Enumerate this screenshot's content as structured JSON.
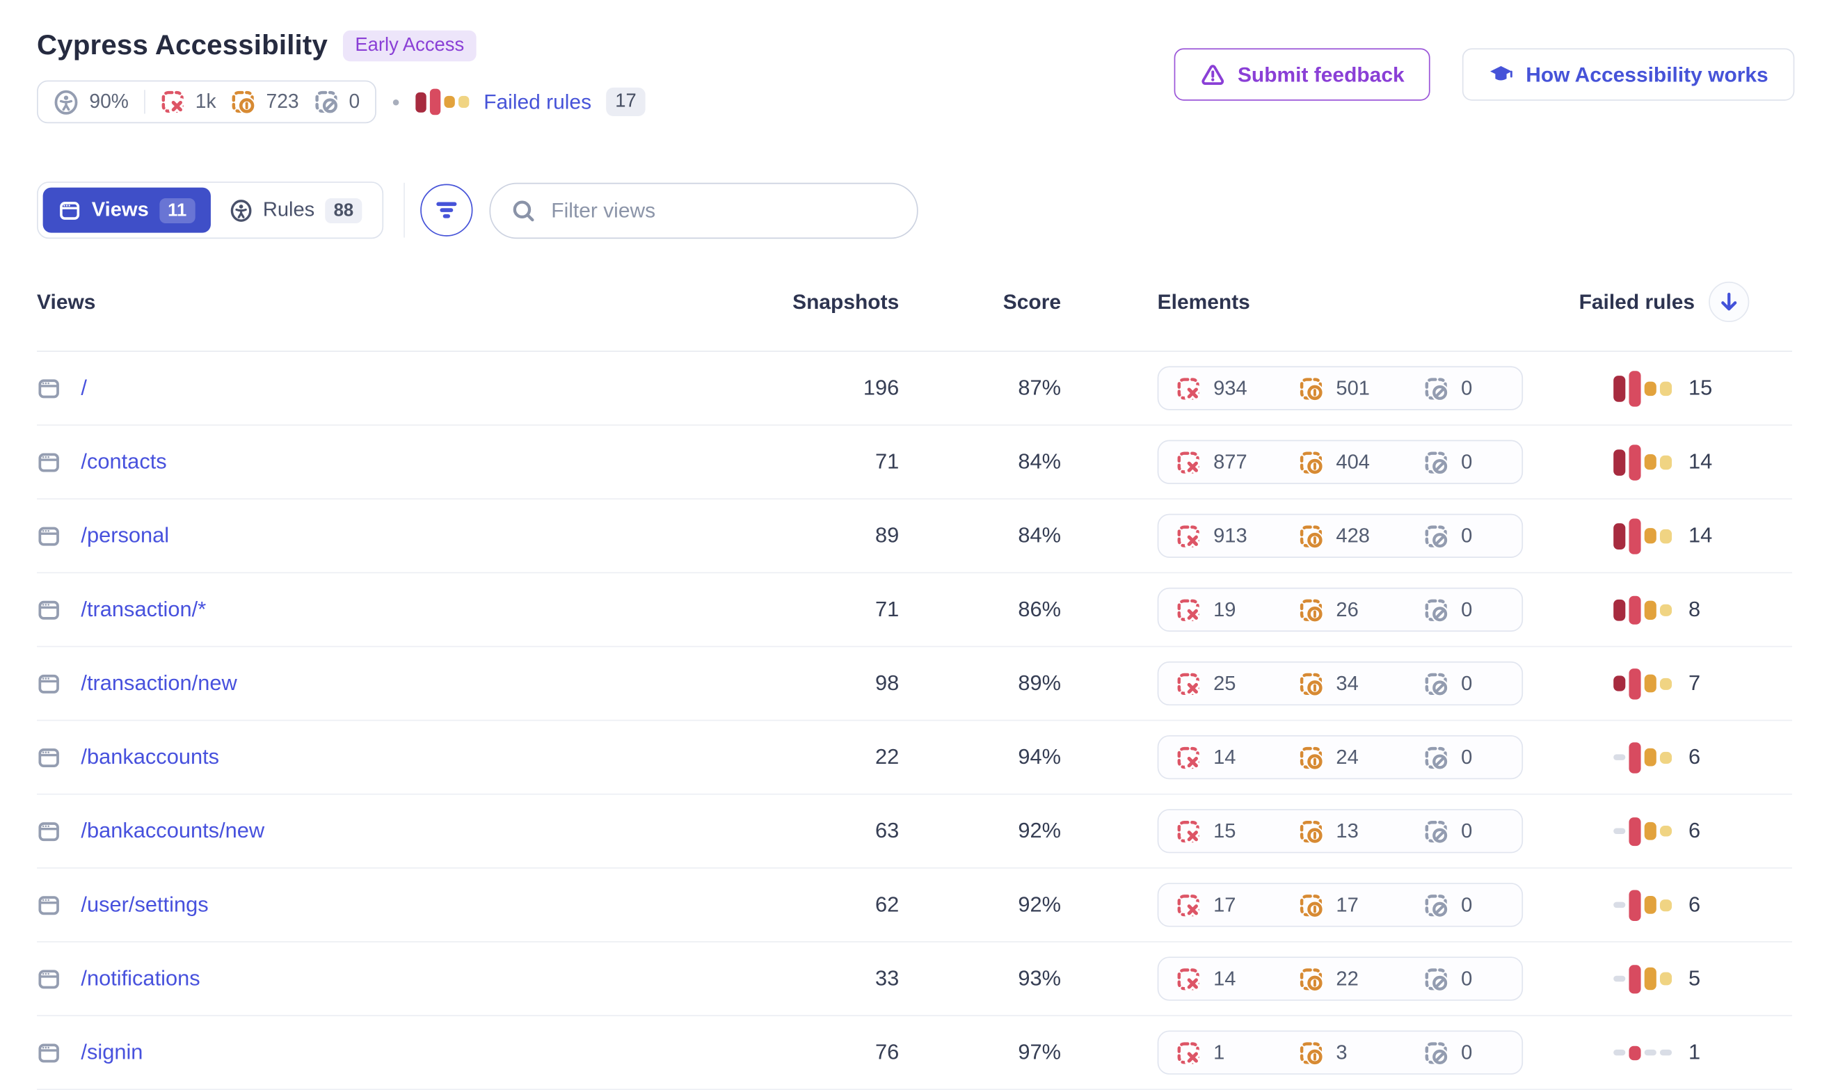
{
  "colors": {
    "accent": "#4653d8",
    "link": "#4751dd",
    "tab_active_bg": "#3f4fc8",
    "purple": "#8a3fd6",
    "purple_badge_bg": "#ede5fa",
    "critical": "#a72b3f",
    "serious": "#d84b60",
    "moderate": "#e2a23c",
    "minor": "#f0d483",
    "zero_dash": "#d9dde6",
    "failed_icon": "#dd5566",
    "inconclusive_icon": "#d78a33",
    "ignored_icon": "#939cb0"
  },
  "header": {
    "title": "Cypress Accessibility",
    "badge": "Early Access",
    "feedback_button": "Submit feedback",
    "docs_button": "How Accessibility works",
    "stats": {
      "score": "90%",
      "failed_elements": "1k",
      "inconclusive_elements": "723",
      "ignored_elements": "0",
      "failed_rules_label": "Failed rules",
      "failed_rules_count": "17",
      "severity_bars": [
        17,
        22,
        10,
        10
      ]
    }
  },
  "toolbar": {
    "views_tab": {
      "label": "Views",
      "count": "11"
    },
    "rules_tab": {
      "label": "Rules",
      "count": "88"
    },
    "search_placeholder": "Filter views"
  },
  "table": {
    "columns": {
      "views": "Views",
      "snapshots": "Snapshots",
      "score": "Score",
      "elements": "Elements",
      "failed_rules": "Failed rules"
    },
    "rows": [
      {
        "view": "/",
        "snapshots": "196",
        "score": "87%",
        "failed": "934",
        "inconclusive": "501",
        "ignored": "0",
        "failed_rules": "15",
        "severity_bars": [
          22,
          30,
          12,
          12
        ]
      },
      {
        "view": "/contacts",
        "snapshots": "71",
        "score": "84%",
        "failed": "877",
        "inconclusive": "404",
        "ignored": "0",
        "failed_rules": "14",
        "severity_bars": [
          22,
          30,
          13,
          12
        ]
      },
      {
        "view": "/personal",
        "snapshots": "89",
        "score": "84%",
        "failed": "913",
        "inconclusive": "428",
        "ignored": "0",
        "failed_rules": "14",
        "severity_bars": [
          22,
          30,
          13,
          12
        ]
      },
      {
        "view": "/transaction/*",
        "snapshots": "71",
        "score": "86%",
        "failed": "19",
        "inconclusive": "26",
        "ignored": "0",
        "failed_rules": "8",
        "severity_bars": [
          18,
          24,
          16,
          10
        ]
      },
      {
        "view": "/transaction/new",
        "snapshots": "98",
        "score": "89%",
        "failed": "25",
        "inconclusive": "34",
        "ignored": "0",
        "failed_rules": "7",
        "severity_bars": [
          13,
          26,
          15,
          10
        ]
      },
      {
        "view": "/bankaccounts",
        "snapshots": "22",
        "score": "94%",
        "failed": "14",
        "inconclusive": "24",
        "ignored": "0",
        "failed_rules": "6",
        "severity_bars": [
          0,
          26,
          15,
          10
        ]
      },
      {
        "view": "/bankaccounts/new",
        "snapshots": "63",
        "score": "92%",
        "failed": "15",
        "inconclusive": "13",
        "ignored": "0",
        "failed_rules": "6",
        "severity_bars": [
          0,
          24,
          15,
          9
        ]
      },
      {
        "view": "/user/settings",
        "snapshots": "62",
        "score": "92%",
        "failed": "17",
        "inconclusive": "17",
        "ignored": "0",
        "failed_rules": "6",
        "severity_bars": [
          0,
          26,
          15,
          10
        ]
      },
      {
        "view": "/notifications",
        "snapshots": "33",
        "score": "93%",
        "failed": "14",
        "inconclusive": "22",
        "ignored": "0",
        "failed_rules": "5",
        "severity_bars": [
          0,
          24,
          19,
          11
        ]
      },
      {
        "view": "/signin",
        "snapshots": "76",
        "score": "97%",
        "failed": "1",
        "inconclusive": "3",
        "ignored": "0",
        "failed_rules": "1",
        "severity_bars": [
          0,
          12,
          0,
          0
        ]
      }
    ]
  }
}
